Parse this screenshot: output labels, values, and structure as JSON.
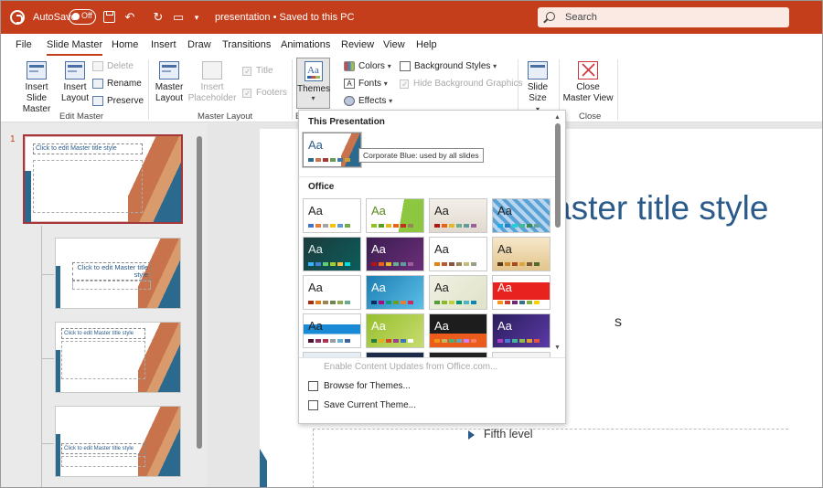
{
  "titlebar": {
    "autosave_label": "AutoSave",
    "autosave_state": "Off",
    "doc_title": "presentation • Saved to this PC",
    "search_placeholder": "Search"
  },
  "tabs": [
    "File",
    "Slide Master",
    "Home",
    "Insert",
    "Draw",
    "Transitions",
    "Animations",
    "Review",
    "View",
    "Help"
  ],
  "active_tab": "Slide Master",
  "ribbon": {
    "edit_master": {
      "label": "Edit Master",
      "insert_slide_master": "Insert Slide Master",
      "insert_layout": "Insert Layout",
      "delete": "Delete",
      "rename": "Rename",
      "preserve": "Preserve"
    },
    "master_layout": {
      "label": "Master Layout",
      "master_layout_btn": "Master Layout",
      "insert_placeholder": "Insert Placeholder",
      "title": "Title",
      "footers": "Footers"
    },
    "edit_theme": {
      "themes": "Themes",
      "colors": "Colors",
      "fonts": "Fonts",
      "effects": "Effects",
      "background_styles": "Background Styles",
      "hide_background_graphics": "Hide Background Graphics",
      "edit_label_fragment": "E"
    },
    "size": {
      "slide_size": "Slide Size"
    },
    "close": {
      "label": "Close",
      "close_master_view": "Close Master View"
    }
  },
  "thumbnails": {
    "selected_number": "1",
    "items": [
      {
        "title": "Click to edit Master title style"
      },
      {
        "title": "Click to edit Master title style"
      },
      {
        "title": "Click to edit Master title style"
      },
      {
        "title": "Click to edit Master title style"
      }
    ]
  },
  "slide": {
    "title_fragment": "aster title style",
    "body_fragment": "s",
    "fifth_level": "Fifth level"
  },
  "themes_dropdown": {
    "this_presentation_header": "This Presentation",
    "office_header": "Office",
    "tile_text": "Aa",
    "tooltip": "Corporate Blue: used by all slides",
    "enable_updates": "Enable Content Updates from Office.com...",
    "browse": "Browse for Themes...",
    "save_current": "Save Current Theme..."
  },
  "colors": {
    "brand": "#c43e1c",
    "slide_title": "#2b5b8a"
  }
}
